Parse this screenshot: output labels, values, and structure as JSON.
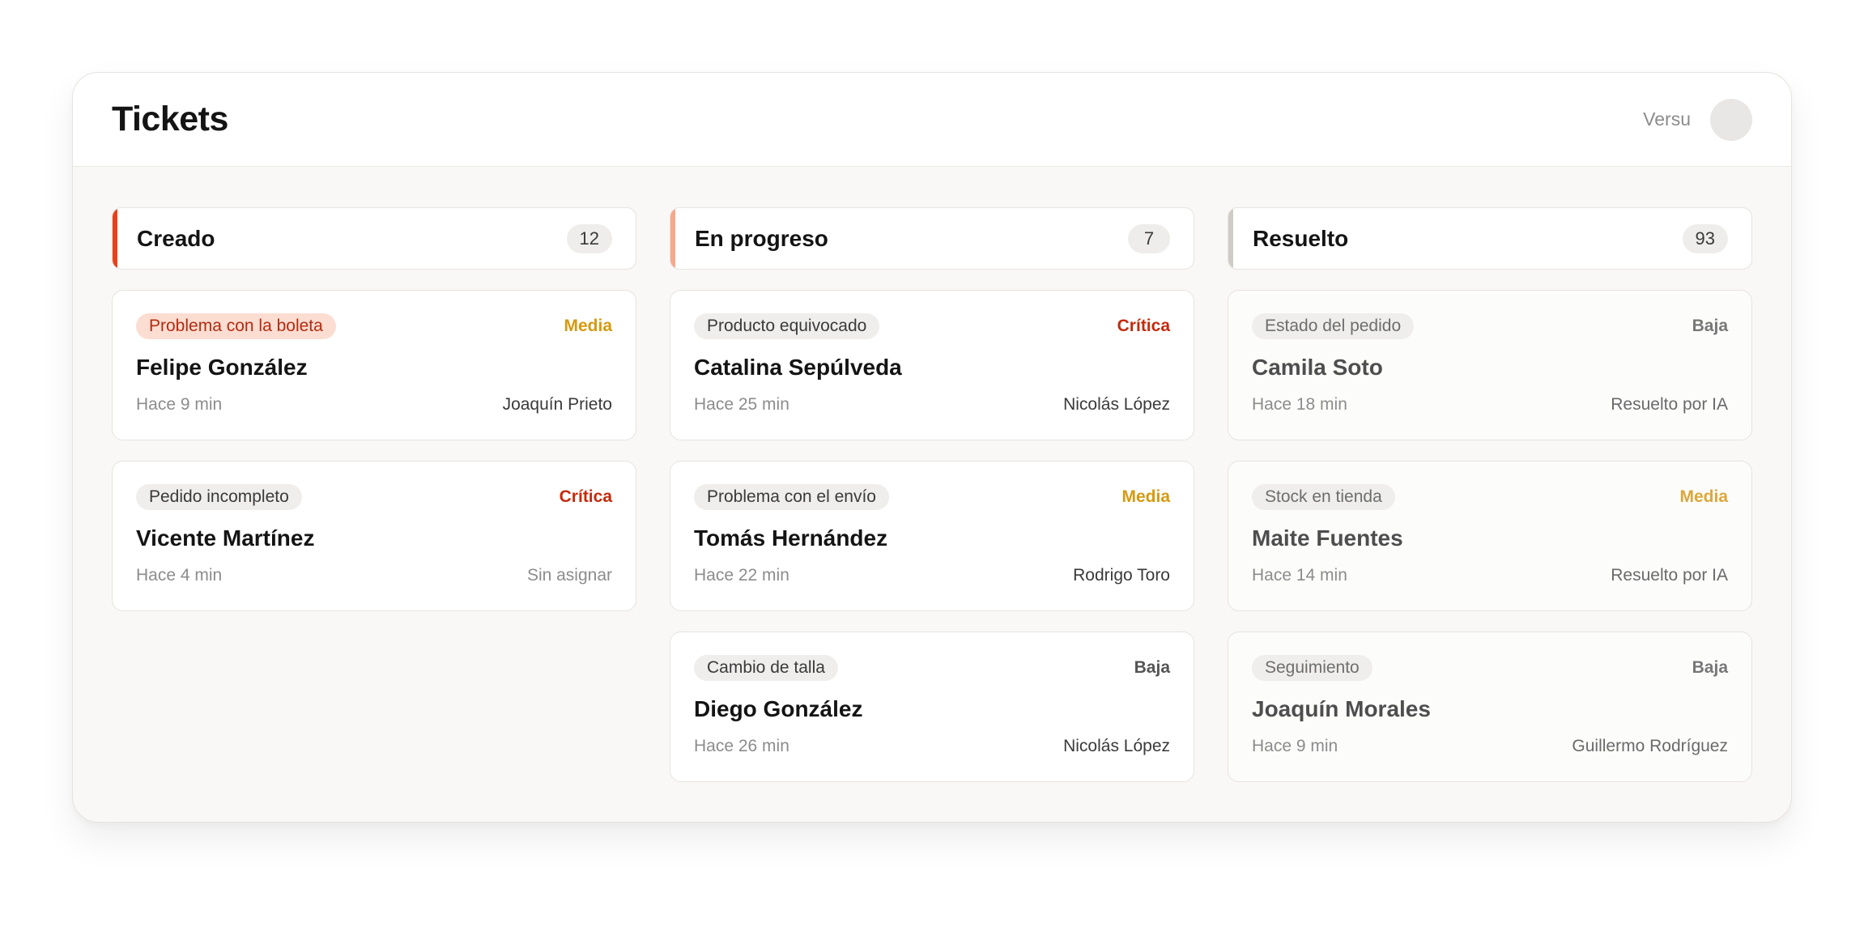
{
  "header": {
    "title": "Tickets",
    "user_name": "Versu"
  },
  "colors": {
    "created_accent": "#e8401c",
    "in_progress_accent": "#f5a88c",
    "resolved_accent": "#cfcbc5",
    "priority_critica": "#c42a0d",
    "priority_media": "#d69a10",
    "priority_baja": "#555555"
  },
  "columns": [
    {
      "title": "Creado",
      "count": "12",
      "cards": [
        {
          "tag": "Problema con la boleta",
          "priority": "Media",
          "name": "Felipe González",
          "time": "Hace 9 min",
          "assignee": "Joaquín Prieto"
        },
        {
          "tag": "Pedido incompleto",
          "priority": "Crítica",
          "name": "Vicente Martínez",
          "time": "Hace 4 min",
          "assignee": "Sin asignar"
        }
      ]
    },
    {
      "title": "En progreso",
      "count": "7",
      "cards": [
        {
          "tag": "Producto equivocado",
          "priority": "Crítica",
          "name": "Catalina Sepúlveda",
          "time": "Hace 25 min",
          "assignee": "Nicolás López"
        },
        {
          "tag": "Problema con el envío",
          "priority": "Media",
          "name": "Tomás Hernández",
          "time": "Hace 22 min",
          "assignee": "Rodrigo Toro"
        },
        {
          "tag": "Cambio de talla",
          "priority": "Baja",
          "name": "Diego González",
          "time": "Hace 26 min",
          "assignee": "Nicolás López"
        }
      ]
    },
    {
      "title": "Resuelto",
      "count": "93",
      "cards": [
        {
          "tag": "Estado del pedido",
          "priority": "Baja",
          "name": "Camila Soto",
          "time": "Hace 18 min",
          "assignee": "Resuelto por IA"
        },
        {
          "tag": "Stock en tienda",
          "priority": "Media",
          "name": "Maite Fuentes",
          "time": "Hace 14 min",
          "assignee": "Resuelto por IA"
        },
        {
          "tag": "Seguimiento",
          "priority": "Baja",
          "name": "Joaquín Morales",
          "time": "Hace 9 min",
          "assignee": "Guillermo Rodríguez"
        }
      ]
    }
  ]
}
